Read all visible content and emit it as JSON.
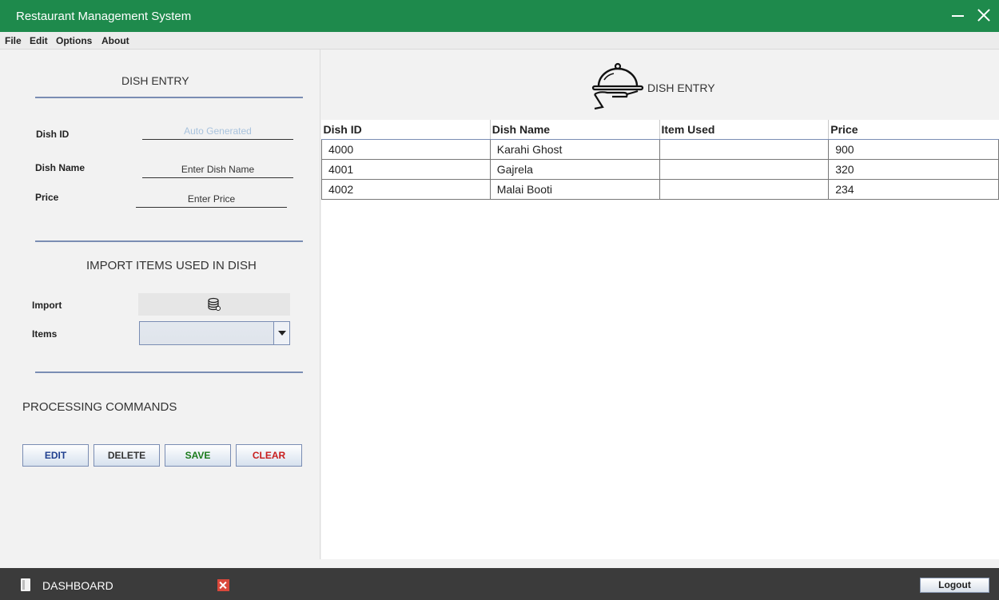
{
  "window": {
    "title": "Restaurant Management System"
  },
  "menu": [
    "File",
    "Edit",
    "Options",
    "About"
  ],
  "form": {
    "title": "DISH ENTRY",
    "dish_id_label": "Dish ID",
    "dish_id_placeholder": "Auto Generated",
    "dish_name_label": "Dish Name",
    "dish_name_value": "Enter Dish Name",
    "price_label": "Price",
    "price_value": "Enter Price"
  },
  "import_section": {
    "title": "IMPORT ITEMS USED IN DISH",
    "import_label": "Import",
    "import_icon": "database-icon",
    "items_label": "Items",
    "items_selected": ""
  },
  "commands": {
    "title": "PROCESSING COMMANDS",
    "edit": "EDIT",
    "delete": "DELETE",
    "save": "SAVE",
    "clear": "CLEAR",
    "colors": {
      "edit": "#1f3f8f",
      "delete": "#333333",
      "save": "#1a7a1a",
      "clear": "#c81e1e"
    }
  },
  "panel": {
    "title": "DISH ENTRY",
    "icon": "serving-cloche-icon"
  },
  "table": {
    "headers": [
      "Dish ID",
      "Dish Name",
      "Item Used",
      "Price"
    ],
    "rows": [
      [
        "4000",
        "Karahi Ghost",
        "",
        "900"
      ],
      [
        "4001",
        "Gajrela",
        "",
        "320"
      ],
      [
        "4002",
        "Malai Booti",
        "",
        "234"
      ]
    ]
  },
  "footer": {
    "dashboard": "DASHBOARD",
    "logout": "Logout"
  },
  "colors": {
    "titlebar": "#1e8a4c",
    "footer": "#3b3b3b",
    "rule": "#7a8db3"
  }
}
